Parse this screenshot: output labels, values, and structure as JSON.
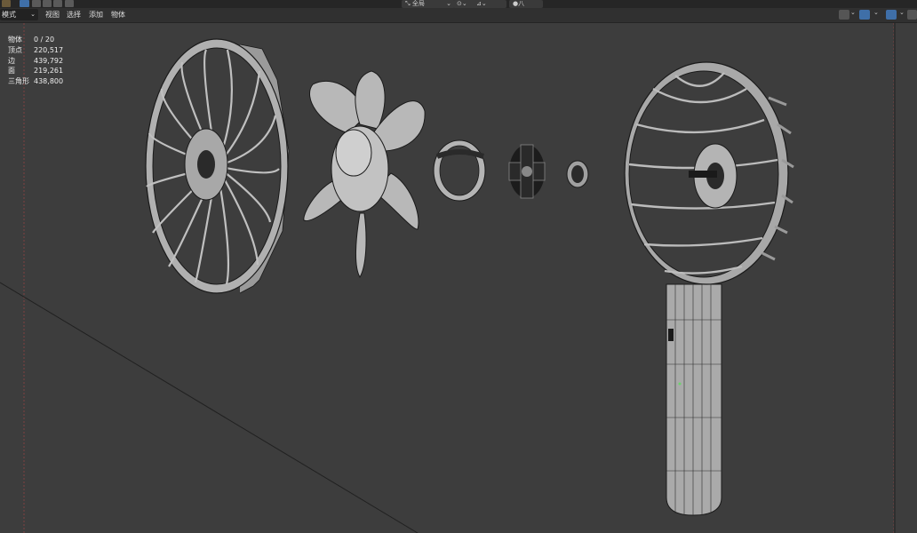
{
  "header": {
    "mode_label": "模式",
    "menus": [
      "视图",
      "选择",
      "添加",
      "物体"
    ],
    "orientation_label": "全局",
    "snap_label": "八"
  },
  "stats": [
    {
      "label": "物体",
      "value": "0 / 20"
    },
    {
      "label": "顶点",
      "value": "220,517"
    },
    {
      "label": "边",
      "value": "439,792"
    },
    {
      "label": "面",
      "value": "219,261"
    },
    {
      "label": "三角形",
      "value": "438,800"
    }
  ],
  "colors": {
    "viewport_bg": "#3d3d3d",
    "header_bg": "#303030",
    "wire": "#1a1a1a",
    "mesh_fill": "#b4b4b4",
    "active_icon": "#3f6fa8"
  },
  "icons": [
    "editor-type-icon",
    "select-box-icon",
    "transform-orientation-icon",
    "pivot-icon",
    "snap-icon",
    "proportional-edit-icon",
    "visibility-icon",
    "gizmo-icon",
    "overlay-icon",
    "shading-icon"
  ]
}
